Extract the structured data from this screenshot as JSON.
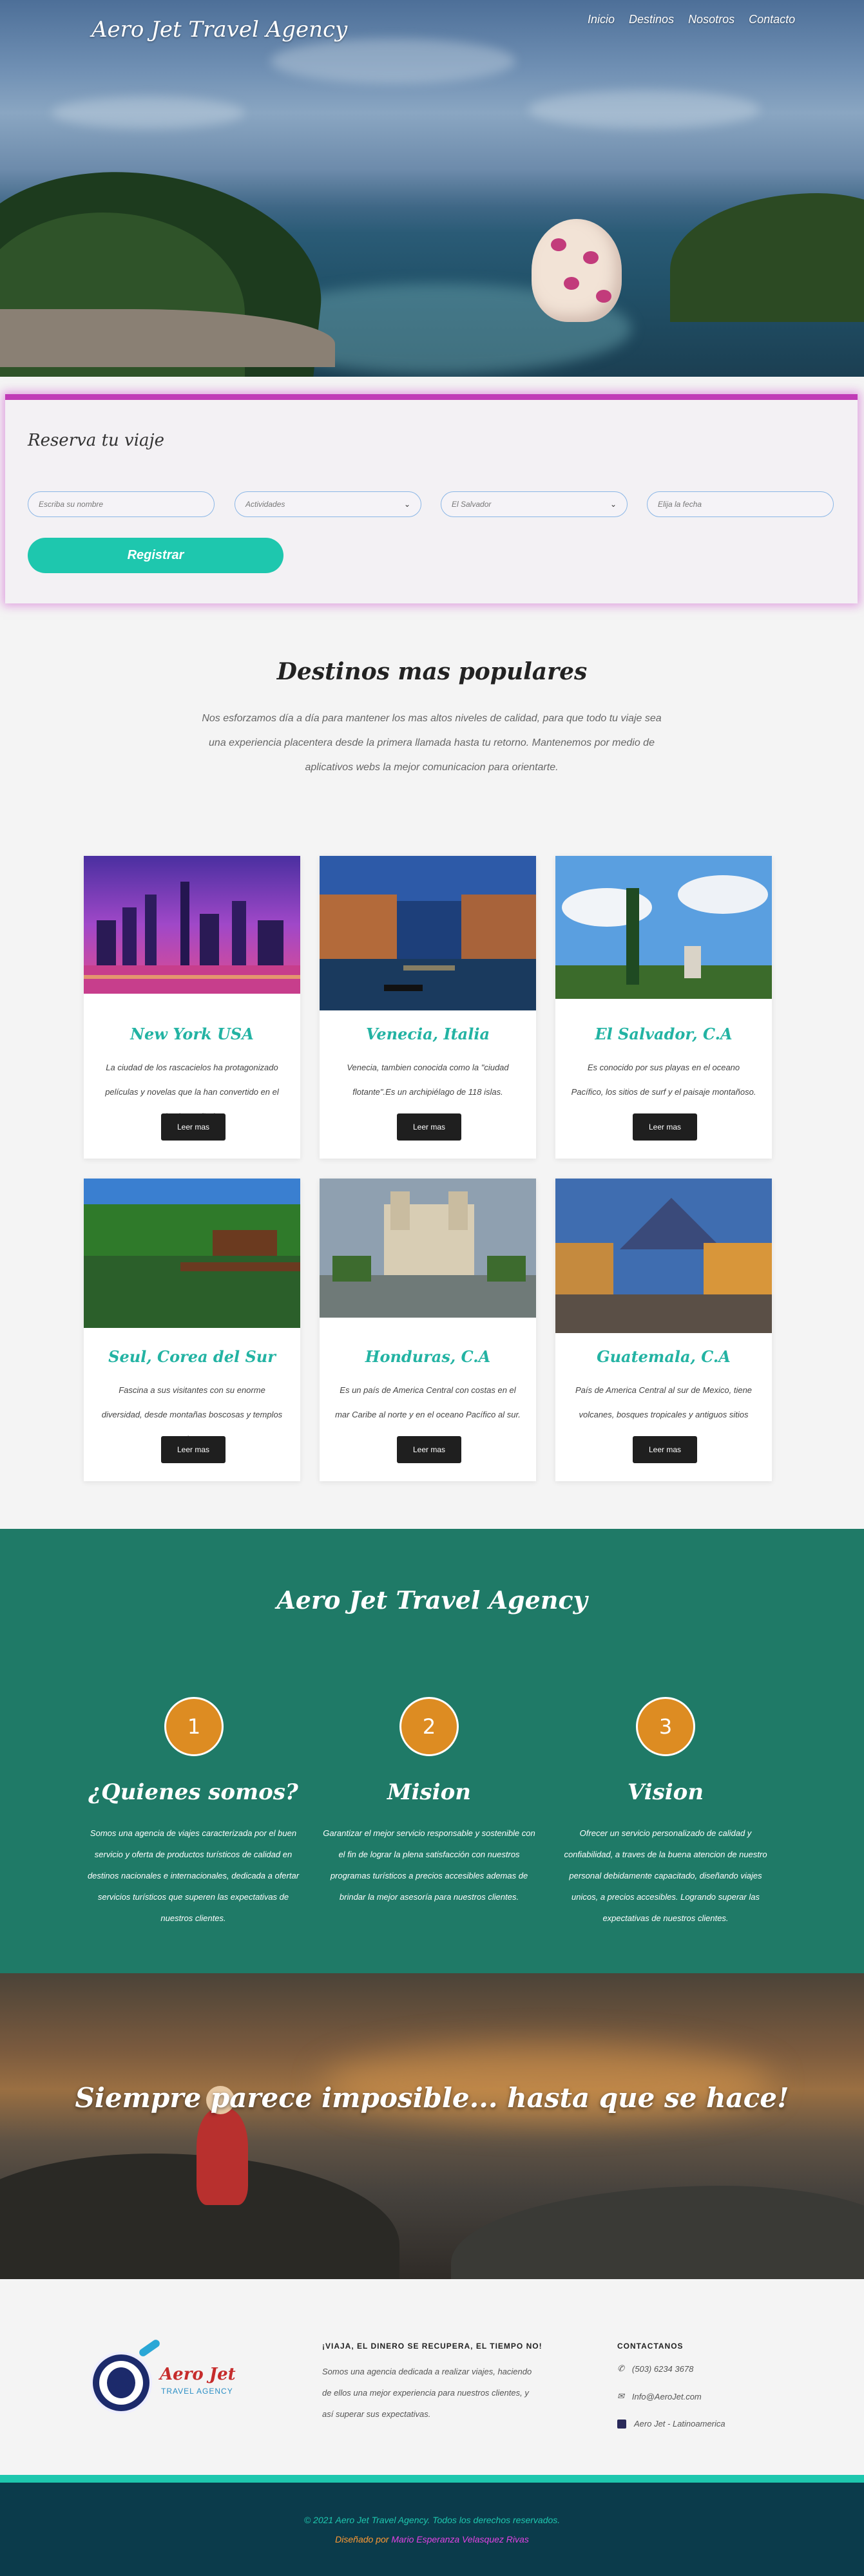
{
  "header": {
    "logo": "Aero Jet Travel Agency",
    "nav": [
      "Inicio",
      "Destinos",
      "Nosotros",
      "Contacto"
    ]
  },
  "booking": {
    "title": "Reserva tu viaje",
    "name_placeholder": "Escriba su nombre",
    "activities_value": "Actividades",
    "country_value": "El Salvador",
    "date_placeholder": "Elija la fecha",
    "register_label": "Registrar",
    "accent_color": "#c13bb7",
    "button_color": "#1ec7ae"
  },
  "popular": {
    "title": "Destinos mas populares",
    "description": "Nos esforzamos día a día para mantener los mas altos niveles de calidad, para que todo tu viaje sea una experiencia placentera desde la primera llamada hasta tu retorno. Mantenemos por medio de aplicativos webs la mejor comunicacion para orientarte.",
    "button_label": "Leer mas",
    "cards": [
      {
        "title": "New York USA",
        "desc": "La ciudad de los rascacielos ha protagonizado películas y novelas que la han convertido en el destino soñado."
      },
      {
        "title": "Venecia, Italia",
        "desc": "Venecia, tambien conocida como la \"ciudad flotante\".Es un archipiélago de 118 islas."
      },
      {
        "title": "El Salvador, C.A",
        "desc": "Es conocido por sus playas en el oceano Pacífico, los sitios de surf y el paisaje montañoso."
      },
      {
        "title": "Seul, Corea del Sur",
        "desc": "Fascina a sus visitantes con su enorme diversidad, desde montañas boscosas y templos antiguos."
      },
      {
        "title": "Honduras, C.A",
        "desc": "Es un país de America Central con costas en el mar Caribe al norte y en el oceano Pacífico al sur."
      },
      {
        "title": "Guatemala, C.A",
        "desc": "País de America Central al sur de Mexico, tiene volcanes, bosques tropicales y antiguos sitios mayas."
      }
    ]
  },
  "about": {
    "title": "Aero Jet Travel Agency",
    "columns": [
      {
        "number": "1",
        "title": "¿Quienes somos?",
        "text": "Somos una agencia de viajes caracterizada por el buen servicio y oferta de productos turísticos de calidad en destinos nacionales e internacionales, dedicada a ofertar servicios turísticos que superen las expectativas de nuestros clientes."
      },
      {
        "number": "2",
        "title": "Mision",
        "text": "Garantizar el mejor servicio responsable y sostenible con el fin de lograr la plena satisfacción con nuestros programas turísticos a precios accesibles ademas de brindar la mejor asesoría para nuestros clientes."
      },
      {
        "number": "3",
        "title": "Vision",
        "text": "Ofrecer un servicio personalizado de calidad y confiabilidad, a traves de la buena atencion de nuestro personal debidamente capacitado, diseñando viajes unicos, a precios accesibles. Logrando superar las expectativas de nuestros clientes."
      }
    ],
    "bg_color": "#1f7a67",
    "circle_color": "#dd8c22"
  },
  "quote": {
    "text": "Siempre parece imposible... hasta que se hace!"
  },
  "footer": {
    "logo_name": "Aero Jet",
    "logo_sub": "TRAVEL AGENCY",
    "heading": "¡VIAJA, EL DINERO SE RECUPERA, EL TIEMPO NO!",
    "text": "Somos una agencia dedicada a realizar viajes, haciendo de ellos una mejor experiencia para nuestros clientes, y así superar sus expectativas.",
    "contact_heading": "CONTACTANOS",
    "phone": "(503) 6234 3678",
    "email": "Info@AeroJet.com",
    "facebook": "Aero Jet - Latinoamerica",
    "copyright": "© 2021 Aero Jet Travel Agency. Todos los derechos reservados.",
    "designed_by": "Diseñado por",
    "author": "Mario Esperanza Velasquez Rivas",
    "bottom_color": "#0b3b4b"
  }
}
